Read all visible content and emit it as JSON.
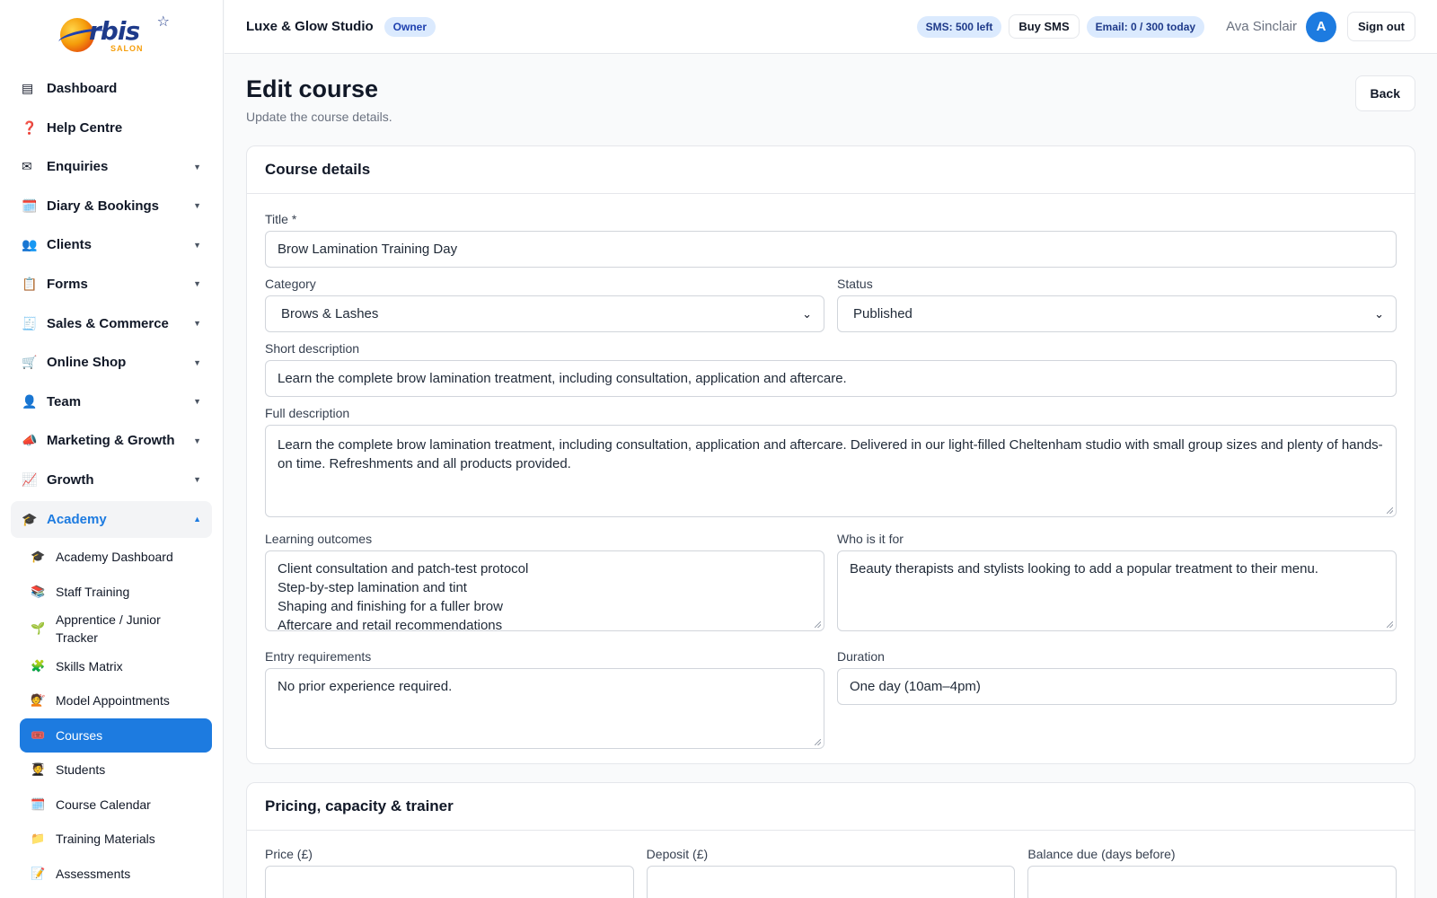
{
  "logo": {
    "word": "rbis",
    "sub": "SALON"
  },
  "sidebar": {
    "items": [
      {
        "icon": "▤",
        "label": "Dashboard"
      },
      {
        "icon": "❓",
        "label": "Help Centre"
      },
      {
        "icon": "✉",
        "label": "Enquiries",
        "caret": "▼"
      },
      {
        "icon": "🗓️",
        "label": "Diary & Bookings",
        "caret": "▼"
      },
      {
        "icon": "👥",
        "label": "Clients",
        "caret": "▼"
      },
      {
        "icon": "📋",
        "label": "Forms",
        "caret": "▼"
      },
      {
        "icon": "🧾",
        "label": "Sales & Commerce",
        "caret": "▼"
      },
      {
        "icon": "🛒",
        "label": "Online Shop",
        "caret": "▼"
      },
      {
        "icon": "👤",
        "label": "Team",
        "caret": "▼"
      },
      {
        "icon": "📣",
        "label": "Marketing & Growth",
        "caret": "▼"
      },
      {
        "icon": "📈",
        "label": "Growth",
        "caret": "▼"
      },
      {
        "icon": "🎓",
        "label": "Academy",
        "caret": "▲"
      }
    ],
    "academy": [
      {
        "icon": "🎓",
        "label": "Academy Dashboard"
      },
      {
        "icon": "📚",
        "label": "Staff Training"
      },
      {
        "icon": "🌱",
        "label": "Apprentice / Junior Tracker"
      },
      {
        "icon": "🧩",
        "label": "Skills Matrix"
      },
      {
        "icon": "💇",
        "label": "Model Appointments"
      },
      {
        "icon": "🎟️",
        "label": "Courses"
      },
      {
        "icon": "🧑‍🎓",
        "label": "Students"
      },
      {
        "icon": "🗓️",
        "label": "Course Calendar"
      },
      {
        "icon": "📁",
        "label": "Training Materials"
      },
      {
        "icon": "📝",
        "label": "Assessments"
      }
    ]
  },
  "topbar": {
    "studio": "Luxe & Glow Studio",
    "role": "Owner",
    "sms": "SMS: 500 left",
    "buy_sms": "Buy SMS",
    "email": "Email: 0 / 300 today",
    "user": "Ava Sinclair",
    "avatar": "A",
    "signout": "Sign out"
  },
  "page": {
    "title": "Edit course",
    "subtitle": "Update the course details.",
    "back": "Back"
  },
  "course_details": {
    "heading": "Course details",
    "title_label": "Title *",
    "title_value": "Brow Lamination Training Day",
    "category_label": "Category",
    "category_value": "Brows & Lashes",
    "status_label": "Status",
    "status_value": "Published",
    "short_label": "Short description",
    "short_value": "Learn the complete brow lamination treatment, including consultation, application and aftercare.",
    "full_label": "Full description",
    "full_value": "Learn the complete brow lamination treatment, including consultation, application and aftercare. Delivered in our light-filled Cheltenham studio with small group sizes and plenty of hands-on time. Refreshments and all products provided.",
    "outcomes_label": "Learning outcomes",
    "outcomes_value": "Client consultation and patch-test protocol\nStep-by-step lamination and tint\nShaping and finishing for a fuller brow\nAftercare and retail recommendations",
    "who_label": "Who is it for",
    "who_value": "Beauty therapists and stylists looking to add a popular treatment to their menu.",
    "entry_label": "Entry requirements",
    "entry_value": "No prior experience required.",
    "duration_label": "Duration",
    "duration_value": "One day (10am–4pm)"
  },
  "pricing": {
    "heading": "Pricing, capacity & trainer",
    "price_label": "Price (£)",
    "deposit_label": "Deposit (£)",
    "balance_label": "Balance due (days before)"
  }
}
